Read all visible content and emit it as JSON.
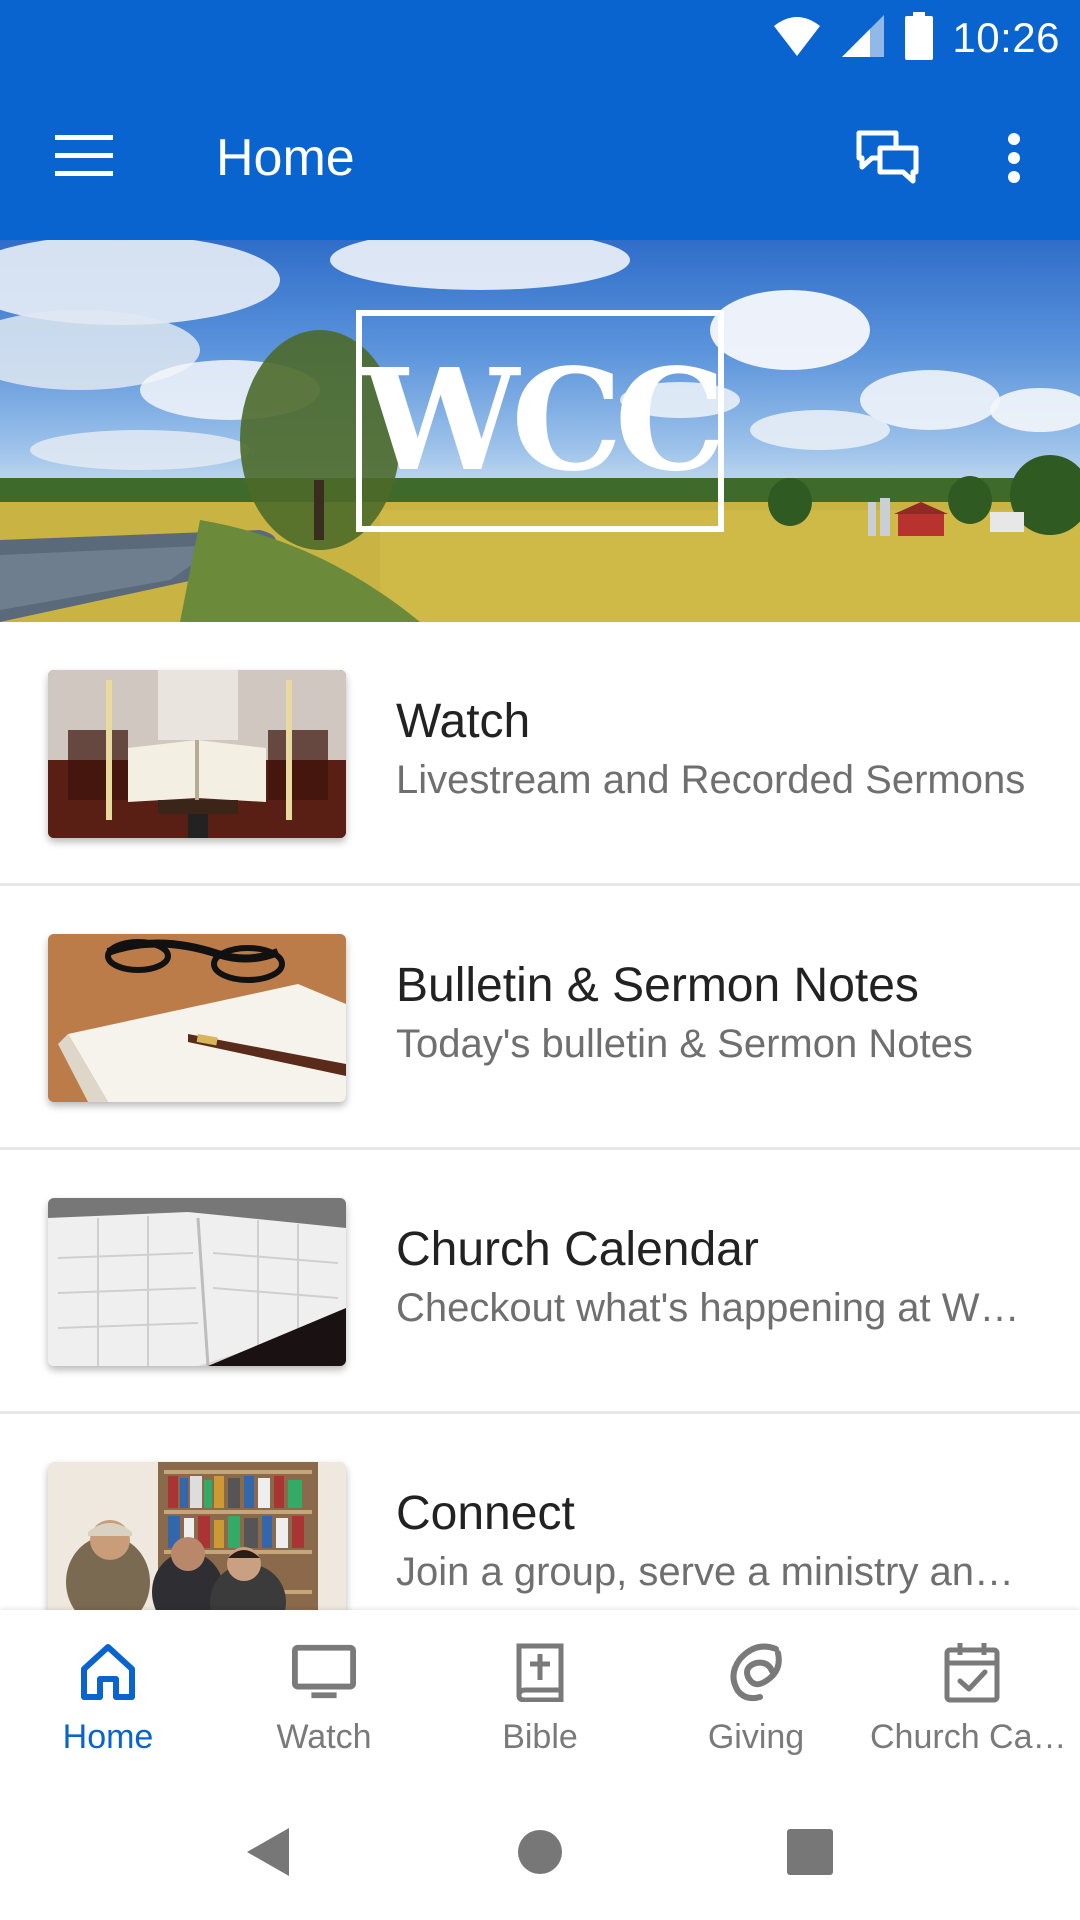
{
  "status_bar": {
    "time": "10:26",
    "icons": [
      "wifi-icon",
      "cell-signal-icon",
      "battery-icon"
    ]
  },
  "app_bar": {
    "title": "Home",
    "menu_icon": "hamburger-menu-icon",
    "chat_icon": "chat-bubbles-icon",
    "more_icon": "more-vert-icon"
  },
  "banner": {
    "logo": "WCC"
  },
  "list": {
    "items": [
      {
        "title": "Watch",
        "subtitle": "Livestream and Recorded Sermons",
        "thumb": "open-bible-on-lectern"
      },
      {
        "title": "Bulletin & Sermon Notes",
        "subtitle": "Today's bulletin & Sermon Notes",
        "thumb": "notebook-pen-glasses"
      },
      {
        "title": "Church Calendar",
        "subtitle": "Checkout what's happening at WCC",
        "thumb": "open-planner"
      },
      {
        "title": "Connect",
        "subtitle": "Join a group, serve a ministry and more",
        "thumb": "people-at-bookshelf"
      }
    ]
  },
  "bottom_nav": {
    "tabs": [
      {
        "label": "Home",
        "icon": "home-icon",
        "active": true
      },
      {
        "label": "Watch",
        "icon": "tv-icon",
        "active": false
      },
      {
        "label": "Bible",
        "icon": "bible-icon",
        "active": false
      },
      {
        "label": "Giving",
        "icon": "giving-icon",
        "active": false
      },
      {
        "label": "Church Calendar",
        "icon": "calendar-check-icon",
        "active": false
      }
    ]
  },
  "colors": {
    "primary": "#0a64d0",
    "inactive": "#7a7a7a",
    "title_text": "#222222",
    "subtitle_text": "#6f6f6f"
  }
}
